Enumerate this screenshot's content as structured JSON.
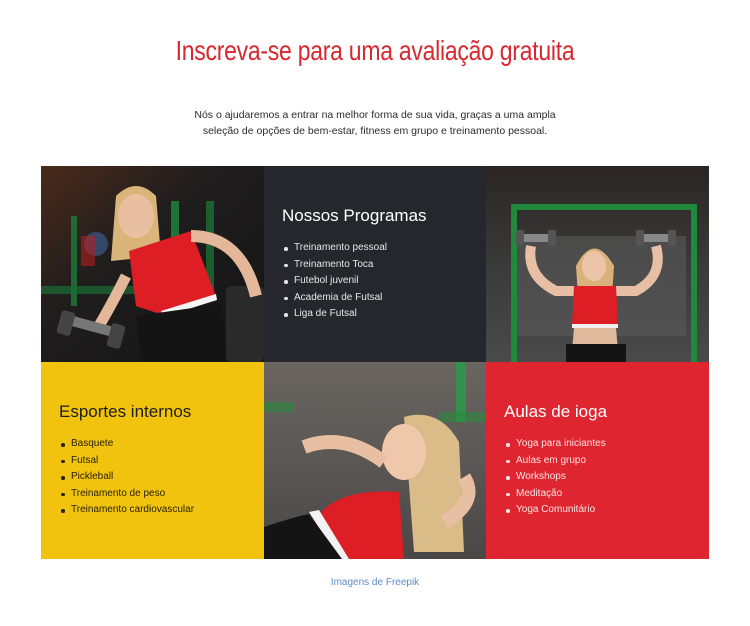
{
  "header": {
    "title": "Inscreva-se para uma avaliação gratuita",
    "subtitle": "Nós o ajudaremos a entrar na melhor forma de sua vida, graças a uma ampla seleção de opções de bem-estar, fitness em grupo e treinamento pessoal."
  },
  "colors": {
    "accent_red": "#df2630",
    "title_red": "#d8272f",
    "dark_panel": "#25272c",
    "yellow_panel": "#f1c30f",
    "link_blue": "#5c8cc4"
  },
  "grid": {
    "images": [
      {
        "name": "woman-dumbbell-bench-photo"
      },
      {
        "name": "woman-shoulder-press-photo"
      },
      {
        "name": "woman-situps-photo"
      }
    ],
    "cards": [
      {
        "title": "Nossos Programas",
        "items": [
          "Treinamento pessoal",
          "Treinamento Toca",
          "Futebol juvenil",
          "Academia de Futsal",
          "Liga de Futsal"
        ]
      },
      {
        "title": "Esportes internos",
        "items": [
          "Basquete",
          "Futsal",
          "Pickleball",
          "Treinamento de peso",
          "Treinamento cardiovascular"
        ]
      },
      {
        "title": "Aulas de ioga",
        "items": [
          "Yoga para iniciantes",
          "Aulas em grupo",
          "Workshops",
          "Meditação",
          "Yoga Comunitário"
        ]
      }
    ]
  },
  "footer": {
    "credit_link": "Imagens de Freepik"
  }
}
